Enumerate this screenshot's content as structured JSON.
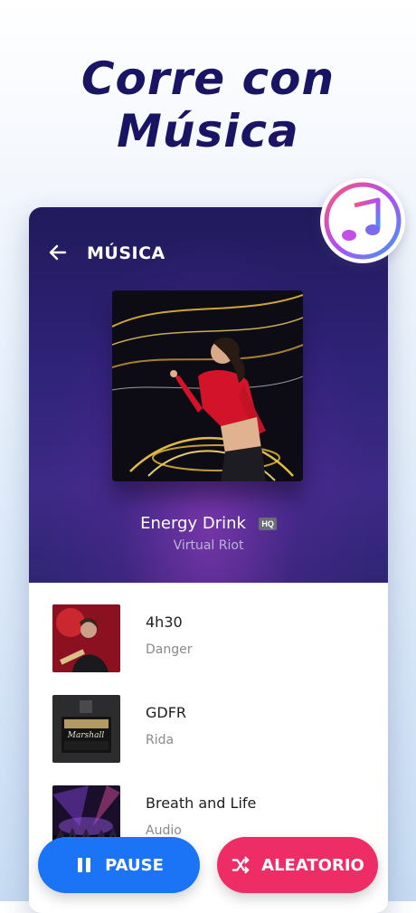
{
  "headline": {
    "line1": "Corre con",
    "line2": "Música"
  },
  "player": {
    "title": "MÚSICA",
    "now_playing": {
      "title": "Energy Drink",
      "badge": "HQ",
      "artist": "Virtual Riot"
    }
  },
  "tracks": [
    {
      "title": "4h30",
      "artist": "Danger"
    },
    {
      "title": "GDFR",
      "artist": "Rida"
    },
    {
      "title": "Breath and Life",
      "artist": "Audio"
    }
  ],
  "buttons": {
    "pause_label": "PAUSE",
    "shuffle_label": "ALEATORIO"
  },
  "colors": {
    "accent_blue": "#1a74f5",
    "accent_pink": "#ee2c66",
    "headline": "#1a1464",
    "player_bg": "#2f2574"
  },
  "icons": {
    "back": "back-arrow-icon",
    "music_app": "music-note-icon",
    "pause": "pause-icon",
    "shuffle": "shuffle-icon"
  }
}
